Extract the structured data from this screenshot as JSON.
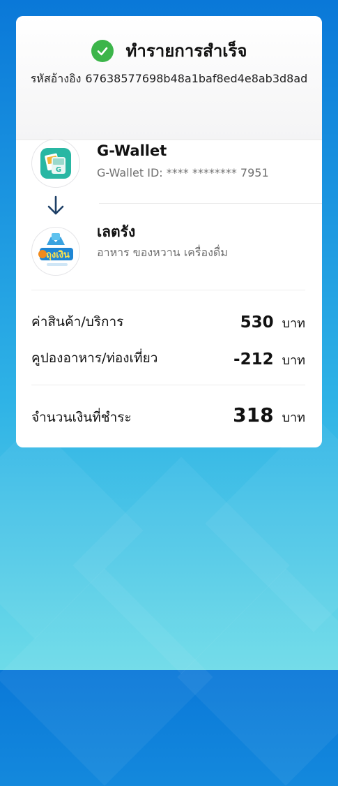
{
  "status": {
    "title": "ทำรายการสำเร็จ"
  },
  "reference": {
    "label": "รหัสอ้างอิง",
    "value": "67638577698b48a1baf8ed4e8ab3d8ad"
  },
  "payer": {
    "name": "G-Wallet",
    "account": "G-Wallet ID: **** ********   7951",
    "icon": "g-wallet-logo"
  },
  "merchant": {
    "name": "เลตรัง",
    "category": "อาหาร ของหวาน เครื่องดื่ม",
    "icon": "thung-ngoen-logo",
    "logo_text": "ถุงเงิน"
  },
  "summary": {
    "goods_label": "ค่าสินค้า/บริการ",
    "goods_amount": "530",
    "coupon_label": "คูปองอาหาร/ท่องเที่ยว",
    "coupon_amount": "-212",
    "total_label": "จำนวนเงินที่ชำระ",
    "total_amount": "318",
    "unit": "บาท"
  },
  "colors": {
    "success": "#3cb54a",
    "arrow": "#1d3f66",
    "background_top": "#0a78d8",
    "background_bottom": "#6ddbe8"
  }
}
